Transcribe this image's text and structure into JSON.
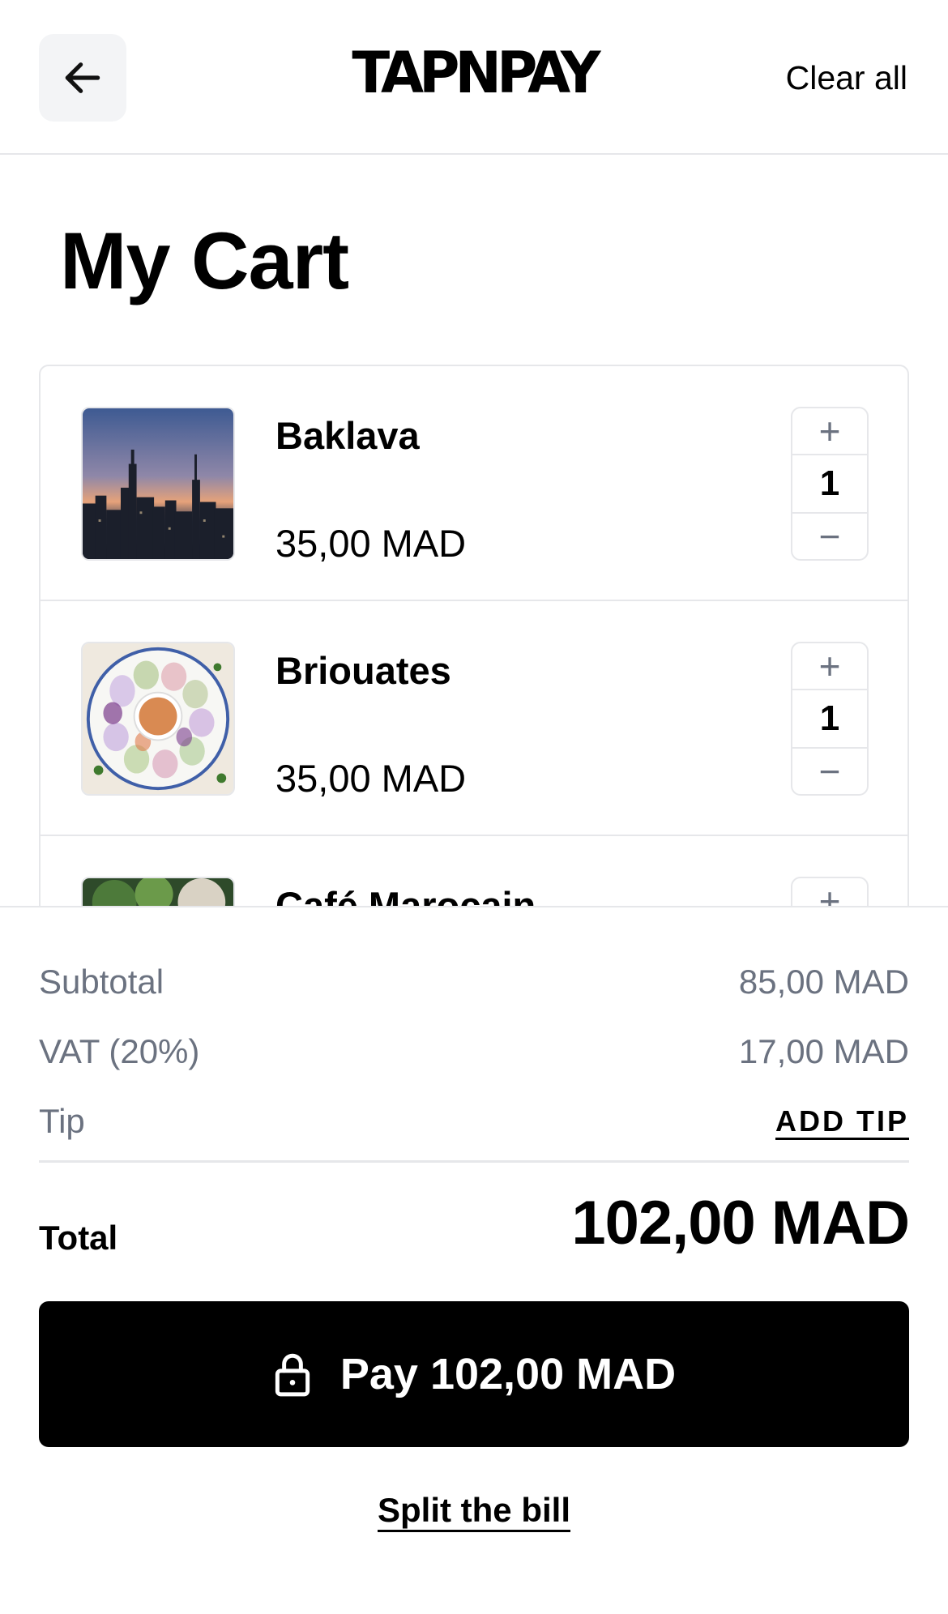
{
  "header": {
    "brand": "TAPNPAY",
    "clear_all": "Clear all",
    "back_icon": "arrow-left-icon"
  },
  "page": {
    "title": "My Cart"
  },
  "cart": {
    "items": [
      {
        "name": "Baklava",
        "price": "35,00 MAD",
        "quantity": "1",
        "image": "city-skyline-photo"
      },
      {
        "name": "Briouates",
        "price": "35,00 MAD",
        "quantity": "1",
        "image": "spring-rolls-photo"
      },
      {
        "name": "Café Marocain",
        "image": "greenery-photo"
      }
    ],
    "increment_symbol": "+",
    "decrement_symbol": "−"
  },
  "summary": {
    "subtotal_label": "Subtotal",
    "subtotal_value": "85,00 MAD",
    "vat_label": "VAT (20%)",
    "vat_value": "17,00 MAD",
    "tip_label": "Tip",
    "add_tip": "ADD TIP",
    "total_label": "Total",
    "total_value": "102,00 MAD"
  },
  "actions": {
    "pay_label": "Pay 102,00 MAD",
    "pay_icon": "lock-icon",
    "split_label": "Split the bill"
  }
}
